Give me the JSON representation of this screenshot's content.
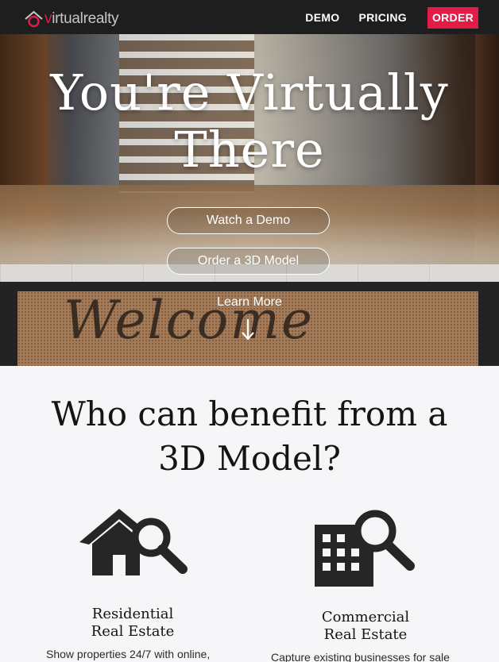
{
  "nav": {
    "logo_text": "virtualrealty",
    "links": [
      {
        "label": "DEMO"
      },
      {
        "label": "PRICING"
      },
      {
        "label": "ORDER"
      }
    ],
    "accent_color": "#e21b47"
  },
  "hero": {
    "title_line1": "You're Virtually",
    "title_line2": "There",
    "watch_demo_label": "Watch a Demo",
    "order_model_label": "Order a 3D Model",
    "learn_more_label": "Learn More",
    "mat_text": "Welcome"
  },
  "benefits": {
    "heading_line1": "Who can benefit from a",
    "heading_line2": "3D Model?",
    "cards": [
      {
        "icon": "house-search-icon",
        "title_line1": "Residential",
        "title_line2": "Real Estate",
        "text": "Show properties 24/7 with online,"
      },
      {
        "icon": "building-search-icon",
        "title_line1": "Commercial",
        "title_line2": "Real Estate",
        "text": "Capture existing businesses for sale"
      }
    ]
  }
}
